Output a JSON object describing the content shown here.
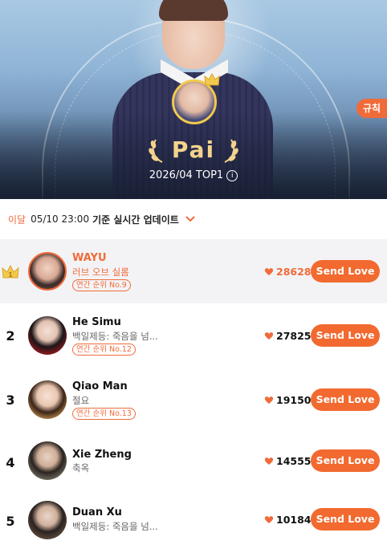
{
  "hero": {
    "name": "Pai",
    "subtitle": "2026/04 TOP1",
    "rules_label": "규칙"
  },
  "update_bar": {
    "prefix": "이달",
    "time": "05/10 23:00",
    "text": "기준 실시간 업데이트"
  },
  "ranking": [
    {
      "rank": "1",
      "name": "WAYU",
      "drama": "러브 오브 실롬",
      "annual": "연간 순위 No.9",
      "score": "28628",
      "button": "Send Love"
    },
    {
      "rank": "2",
      "name": "He Simu",
      "drama": "백일제등: 죽음을 넘...",
      "annual": "연간 순위 No.12",
      "score": "27825",
      "button": "Send Love"
    },
    {
      "rank": "3",
      "name": "Qiao Man",
      "drama": "절요",
      "annual": "연간 순위 No.13",
      "score": "19150",
      "button": "Send Love"
    },
    {
      "rank": "4",
      "name": "Xie Zheng",
      "drama": "축옥",
      "annual": "",
      "score": "14555",
      "button": "Send Love"
    },
    {
      "rank": "5",
      "name": "Duan Xu",
      "drama": "백일제등: 죽음을 넘...",
      "annual": "",
      "score": "10184",
      "button": "Send Love"
    }
  ],
  "colors": {
    "accent": "#f06b3a",
    "gold": "#f4d38c"
  }
}
